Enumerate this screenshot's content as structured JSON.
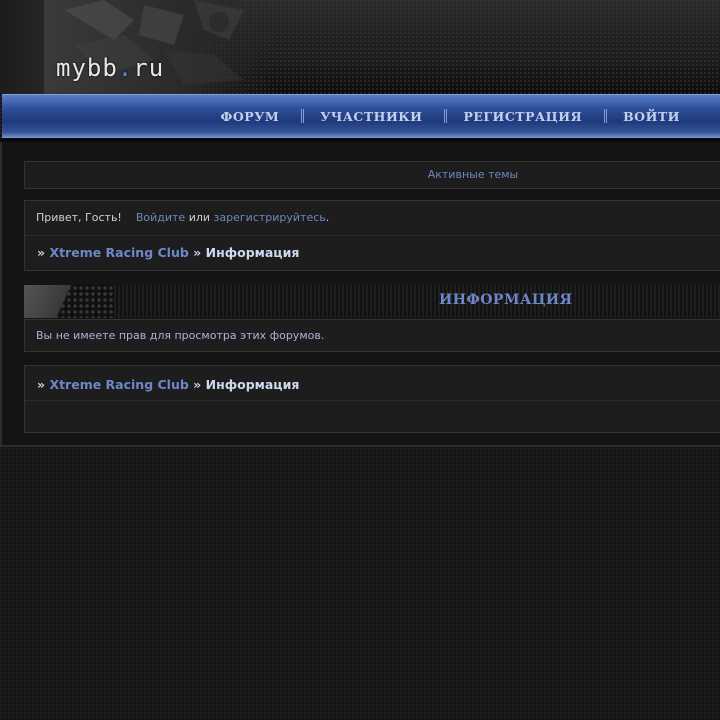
{
  "header": {
    "logo_main": "mybb",
    "logo_dot": ".",
    "logo_tld": "ru"
  },
  "nav": {
    "items": [
      "ФОРУМ",
      "УЧАСТНИКИ",
      "РЕГИСТРАЦИЯ",
      "ВОЙТИ"
    ]
  },
  "active_topics": "Активные темы",
  "welcome": {
    "greeting": "Привет, Гость!",
    "login_link": "Войдите",
    "or": "или",
    "register_link": "зарегистрируйтесь",
    "period": "."
  },
  "breadcrumb": {
    "separator": "»",
    "forum": "Xtreme Racing Club",
    "current": "Информация"
  },
  "section": {
    "title": "ИНФОРМАЦИЯ",
    "message": "Вы не имеете прав для просмотра этих форумов."
  },
  "colors": {
    "accent": "#6d87c9",
    "nav_blue": "#2f4f9a",
    "background": "#161616"
  }
}
